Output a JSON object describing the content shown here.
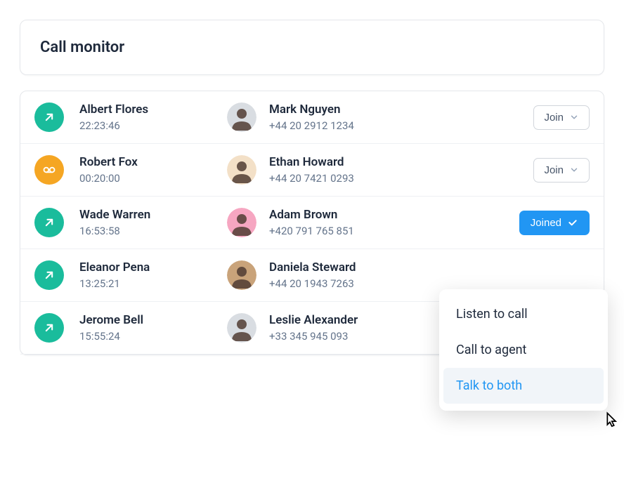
{
  "header": {
    "title": "Call monitor"
  },
  "rows": [
    {
      "icon_type": "outbound",
      "agent_name": "Albert Flores",
      "time": "22:23:46",
      "contact_name": "Mark Nguyen",
      "contact_sub": "+44 20 2912 1234",
      "state": "join",
      "avatar_bg": "#d9dde2"
    },
    {
      "icon_type": "voicemail",
      "agent_name": "Robert Fox",
      "time": "00:20:00",
      "contact_name": "Ethan Howard",
      "contact_sub": "+44 20 7421 0293",
      "state": "join",
      "avatar_bg": "#f3e0c7"
    },
    {
      "icon_type": "outbound",
      "agent_name": "Wade Warren",
      "time": "16:53:58",
      "contact_name": "Adam Brown",
      "contact_sub": "+420 791 765 851",
      "state": "joined",
      "avatar_bg": "#f6a6c1"
    },
    {
      "icon_type": "outbound",
      "agent_name": "Eleanor Pena",
      "time": "13:25:21",
      "contact_name": "Daniela Steward",
      "contact_sub": "+44 20 1943 7263",
      "state": "none",
      "avatar_bg": "#c9a37a"
    },
    {
      "icon_type": "outbound",
      "agent_name": "Jerome Bell",
      "time": "15:55:24",
      "contact_name": "Leslie Alexander",
      "contact_sub": "+33 345 945 093",
      "state": "none",
      "avatar_bg": "#d9dde2"
    }
  ],
  "buttons": {
    "join_label": "Join",
    "joined_label": "Joined"
  },
  "dropdown": {
    "items": [
      {
        "label": "Listen to call",
        "active": false
      },
      {
        "label": "Call to agent",
        "active": false
      },
      {
        "label": "Talk to both",
        "active": true
      }
    ]
  }
}
